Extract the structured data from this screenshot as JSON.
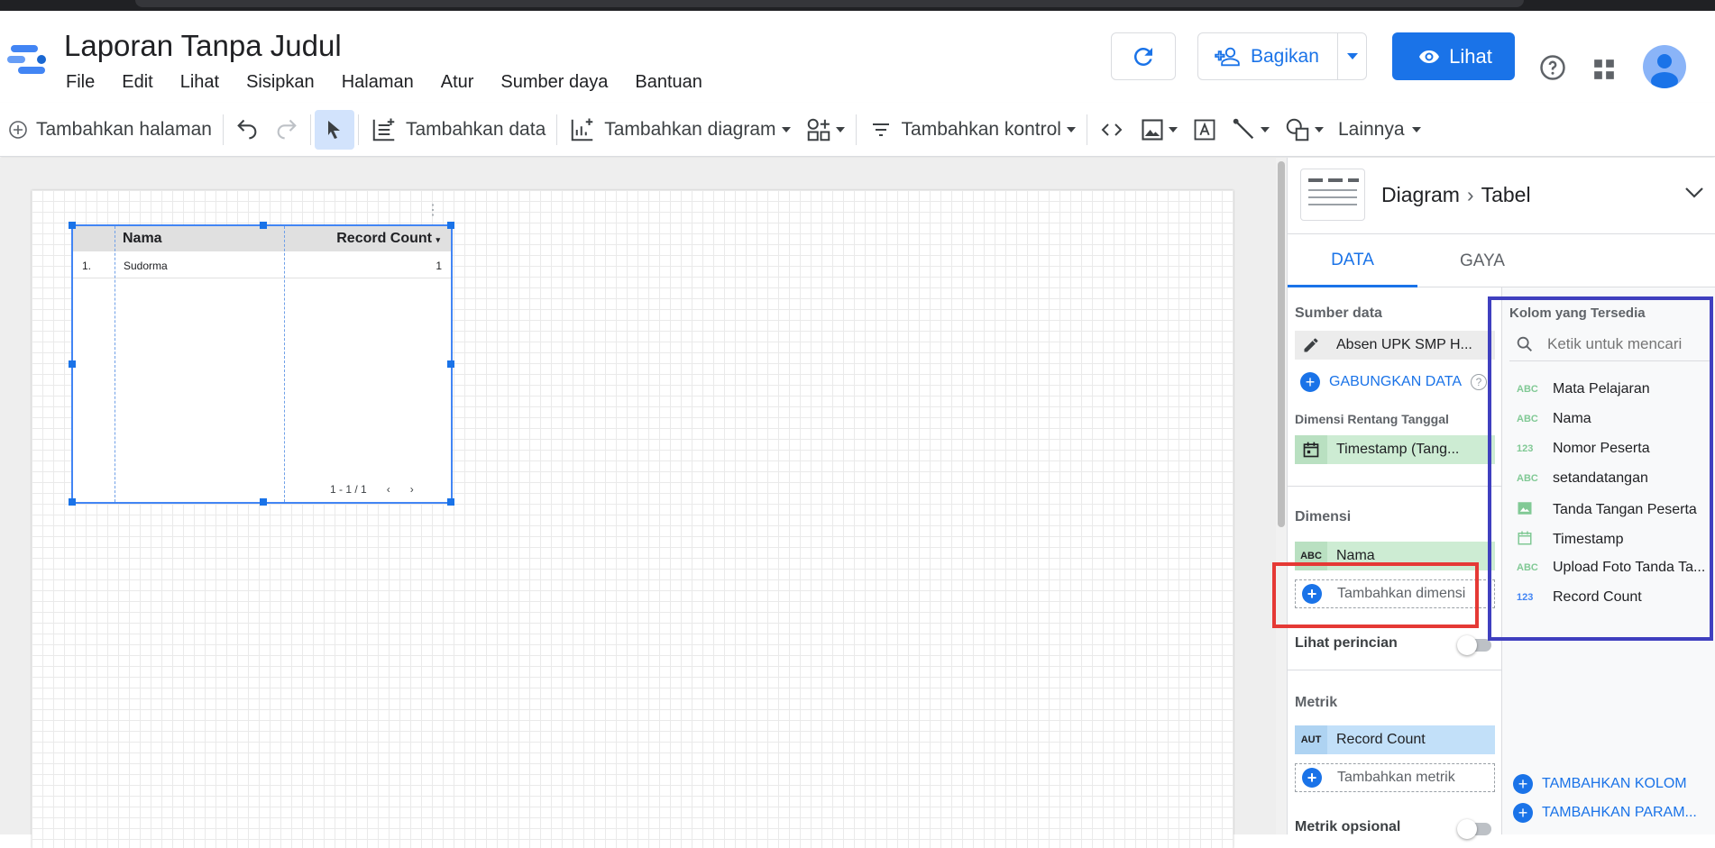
{
  "app": {
    "title": "Laporan Tanpa Judul",
    "menu": [
      "File",
      "Edit",
      "Lihat",
      "Sisipkan",
      "Halaman",
      "Atur",
      "Sumber daya",
      "Bantuan"
    ],
    "share_label": "Bagikan",
    "view_label": "Lihat"
  },
  "toolbar": {
    "add_page": "Tambahkan halaman",
    "add_data": "Tambahkan data",
    "add_chart": "Tambahkan diagram",
    "add_control": "Tambahkan kontrol",
    "more": "Lainnya"
  },
  "table_widget": {
    "headers": [
      "Nama",
      "Record Count"
    ],
    "rows": [
      {
        "index": "1.",
        "nama": "Sudorma",
        "count": "1"
      }
    ],
    "pager": "1 - 1 / 1"
  },
  "panel": {
    "breadcrumb": [
      "Diagram",
      "Tabel"
    ],
    "tabs": [
      "DATA",
      "GAYA"
    ],
    "data_source_label": "Sumber data",
    "data_source": "Absen UPK SMP H...",
    "blend_label": "GABUNGKAN DATA",
    "date_range_label": "Dimensi Rentang Tanggal",
    "date_range_field": "Timestamp (Tang...",
    "dimension_label": "Dimensi",
    "dimension_field": "Nama",
    "add_dimension": "Tambahkan dimensi",
    "drill_label": "Lihat perincian",
    "metric_label": "Metrik",
    "metric_type": "AUT",
    "metric_field": "Record Count",
    "add_metric": "Tambahkan metrik",
    "optional_metric_label": "Metrik opsional",
    "available_label": "Kolom yang Tersedia",
    "search_placeholder": "Ketik untuk mencari",
    "fields": [
      {
        "type": "ABC",
        "name": "Mata Pelajaran"
      },
      {
        "type": "ABC",
        "name": "Nama"
      },
      {
        "type": "123",
        "name": "Nomor Peserta"
      },
      {
        "type": "ABC",
        "name": "setandatangan"
      },
      {
        "type": "image-icon",
        "name": "Tanda Tangan Peserta"
      },
      {
        "type": "calendar-icon",
        "name": "Timestamp"
      },
      {
        "type": "ABC",
        "name": "Upload Foto Tanda Ta..."
      },
      {
        "type": "123",
        "name": "Record Count"
      }
    ],
    "add_field": "TAMBAHKAN KOLOM",
    "add_param": "TAMBAHKAN PARAM..."
  },
  "colors": {
    "accent": "#1a73e8",
    "highlight_red": "#e53935",
    "highlight_blue": "#3f3fbf"
  }
}
